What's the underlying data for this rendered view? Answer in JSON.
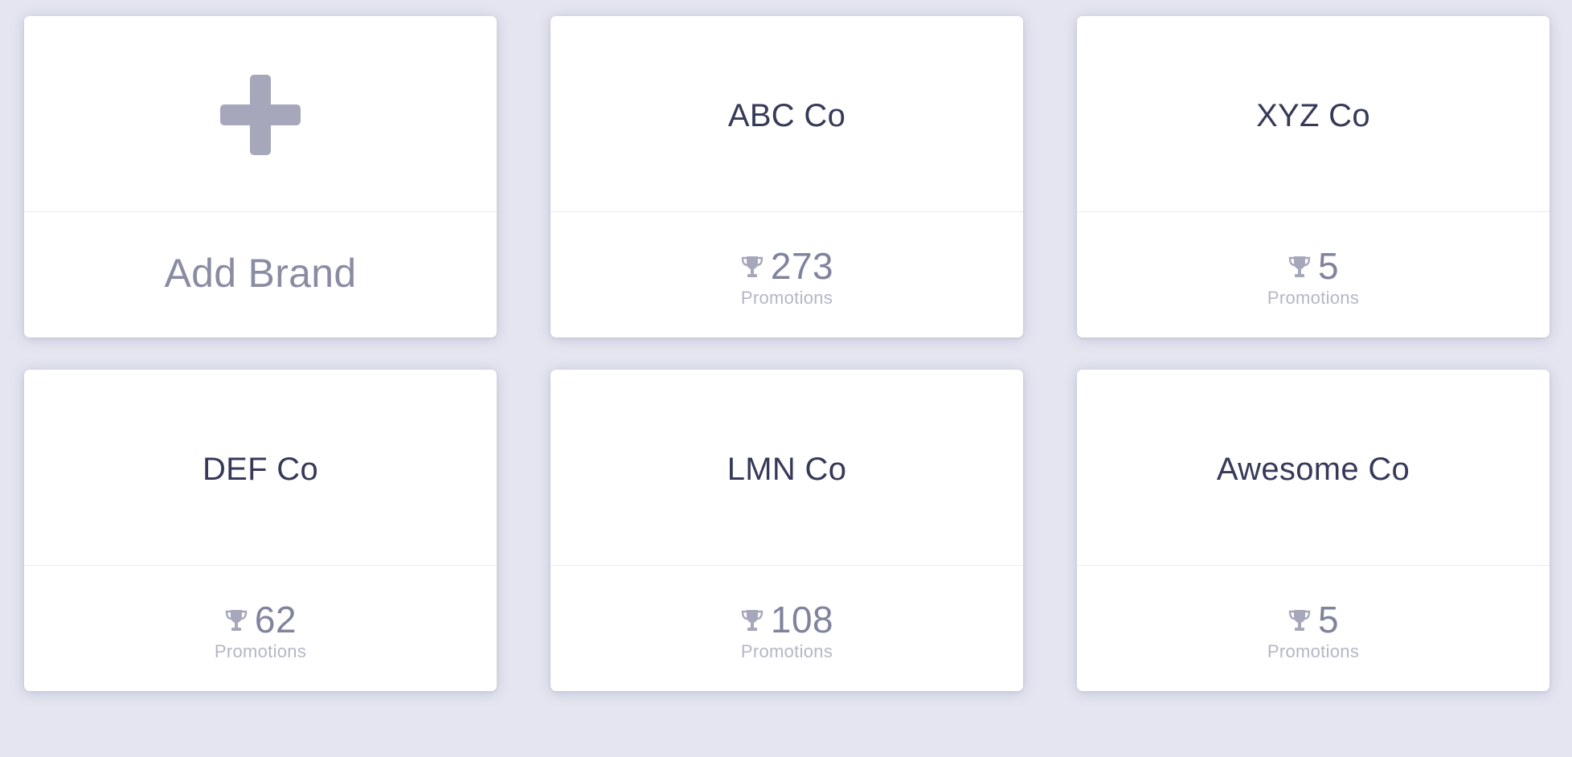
{
  "add_card": {
    "label": "Add Brand",
    "icon": "plus-icon"
  },
  "brands": [
    {
      "name": "ABC Co",
      "count": "273",
      "count_label": "Promotions",
      "icon": "trophy-icon"
    },
    {
      "name": "XYZ Co",
      "count": "5",
      "count_label": "Promotions",
      "icon": "trophy-icon"
    },
    {
      "name": "DEF Co",
      "count": "62",
      "count_label": "Promotions",
      "icon": "trophy-icon"
    },
    {
      "name": "LMN Co",
      "count": "108",
      "count_label": "Promotions",
      "icon": "trophy-icon"
    },
    {
      "name": "Awesome Co",
      "count": "5",
      "count_label": "Promotions",
      "icon": "trophy-icon"
    }
  ],
  "colors": {
    "background": "#e4e5f0",
    "card": "#ffffff",
    "brand_text": "#363a58",
    "count_text": "#80839d",
    "label_text": "#b4b6c6",
    "icon": "#a6a7ba"
  }
}
